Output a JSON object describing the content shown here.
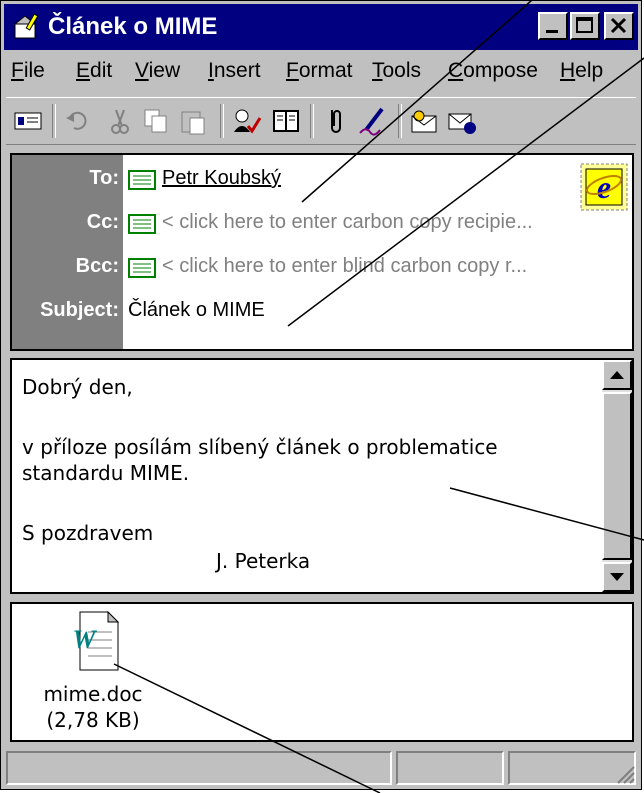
{
  "window": {
    "title": "Článek o MIME"
  },
  "menu": {
    "items": [
      "File",
      "Edit",
      "View",
      "Insert",
      "Format",
      "Tools",
      "Compose",
      "Help"
    ]
  },
  "toolbar": {
    "buttons": [
      "send-icon",
      "undo-icon",
      "cut-icon",
      "copy-icon",
      "paste-icon",
      "check-names-icon",
      "address-book-icon",
      "attach-icon",
      "signature-icon",
      "business-card-icon",
      "digitally-sign-icon"
    ]
  },
  "header": {
    "to_label": "To:",
    "to_value": "Petr Koubský",
    "cc_label": "Cc:",
    "cc_hint": "< click here to enter carbon copy recipie...",
    "bcc_label": "Bcc:",
    "bcc_hint": "< click here to enter blind carbon copy r...",
    "subject_label": "Subject:",
    "subject_value": "Článek o MIME"
  },
  "body": {
    "line1": "Dobrý den,",
    "line2": "v příloze posílám slíbený článek o problematice",
    "line3": "standardu MIME.",
    "line4": "S pozdravem",
    "line5": "J. Peterka"
  },
  "attachment": {
    "filename": "mime.doc",
    "size": "(2,78 KB)"
  },
  "colors": {
    "titlebar": "#000080",
    "chrome": "#c0c0c0",
    "label_column": "#808080"
  }
}
